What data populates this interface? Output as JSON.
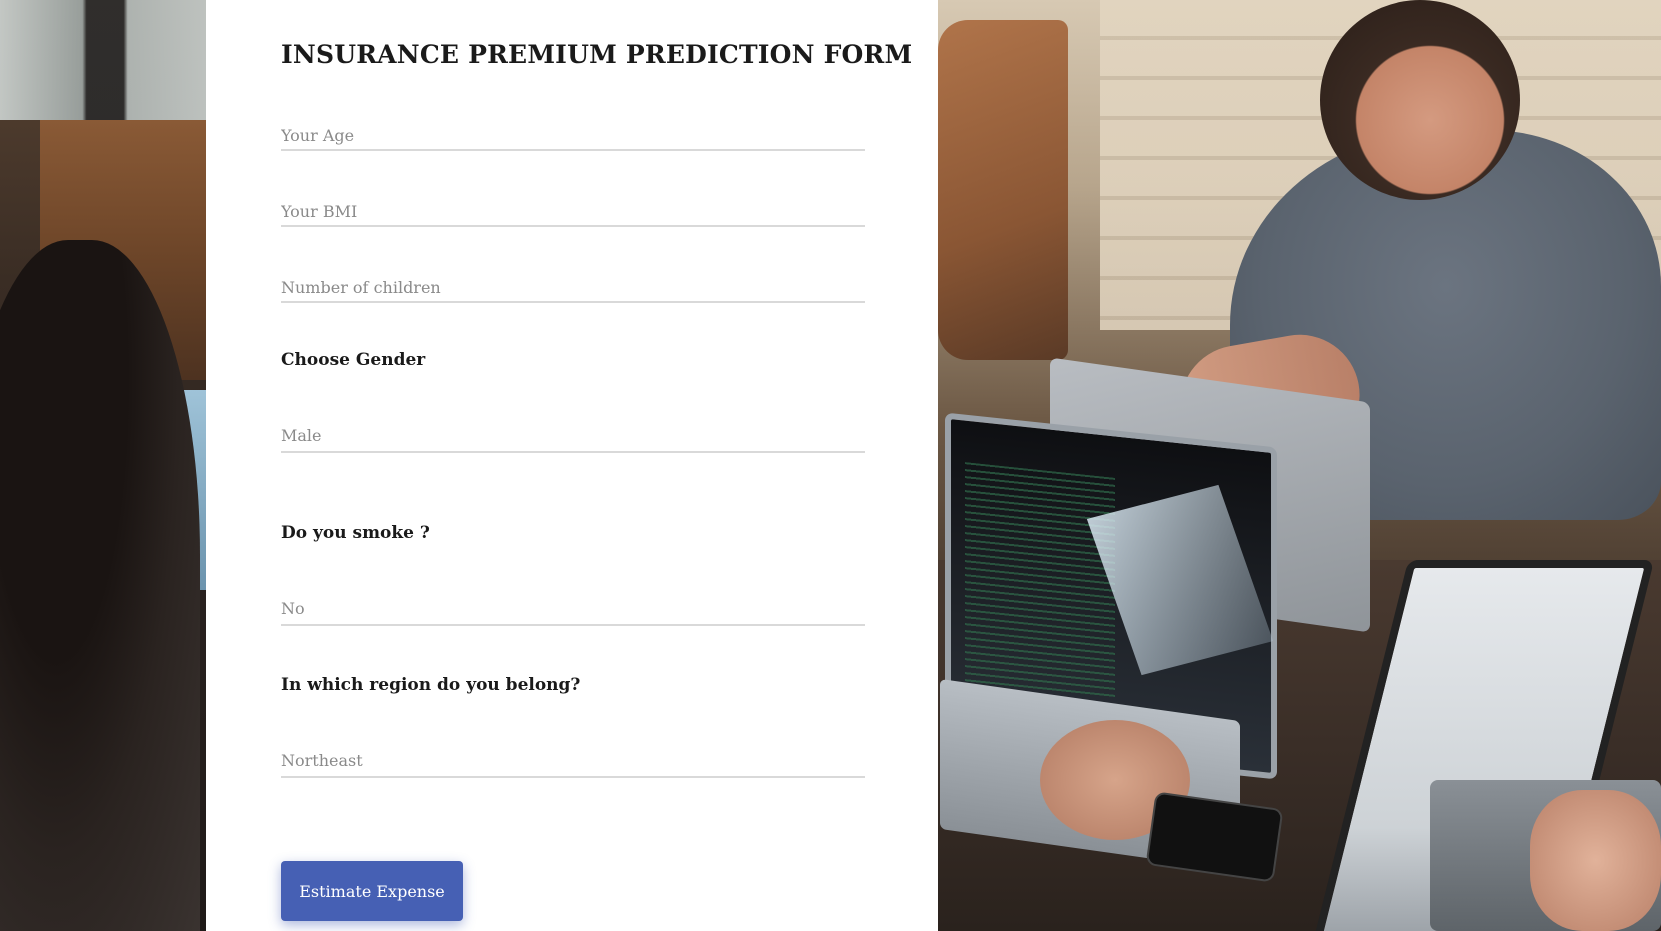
{
  "form": {
    "title": "INSURANCE PREMIUM PREDICTION FORM",
    "age_placeholder": "Your Age",
    "bmi_placeholder": "Your BMI",
    "children_placeholder": "Number of children",
    "gender_label": "Choose Gender",
    "gender_value": "Male",
    "smoke_label": "Do you smoke ?",
    "smoke_value": "No",
    "region_label": "In which region do you belong?",
    "region_value": "Northeast",
    "submit_label": "Estimate Expense"
  },
  "colors": {
    "panel_bg": "#ffffff",
    "button_bg": "#4660b4",
    "button_text": "#ffffff",
    "underline": "#d9d9d9",
    "placeholder": "#8a8a8a"
  }
}
